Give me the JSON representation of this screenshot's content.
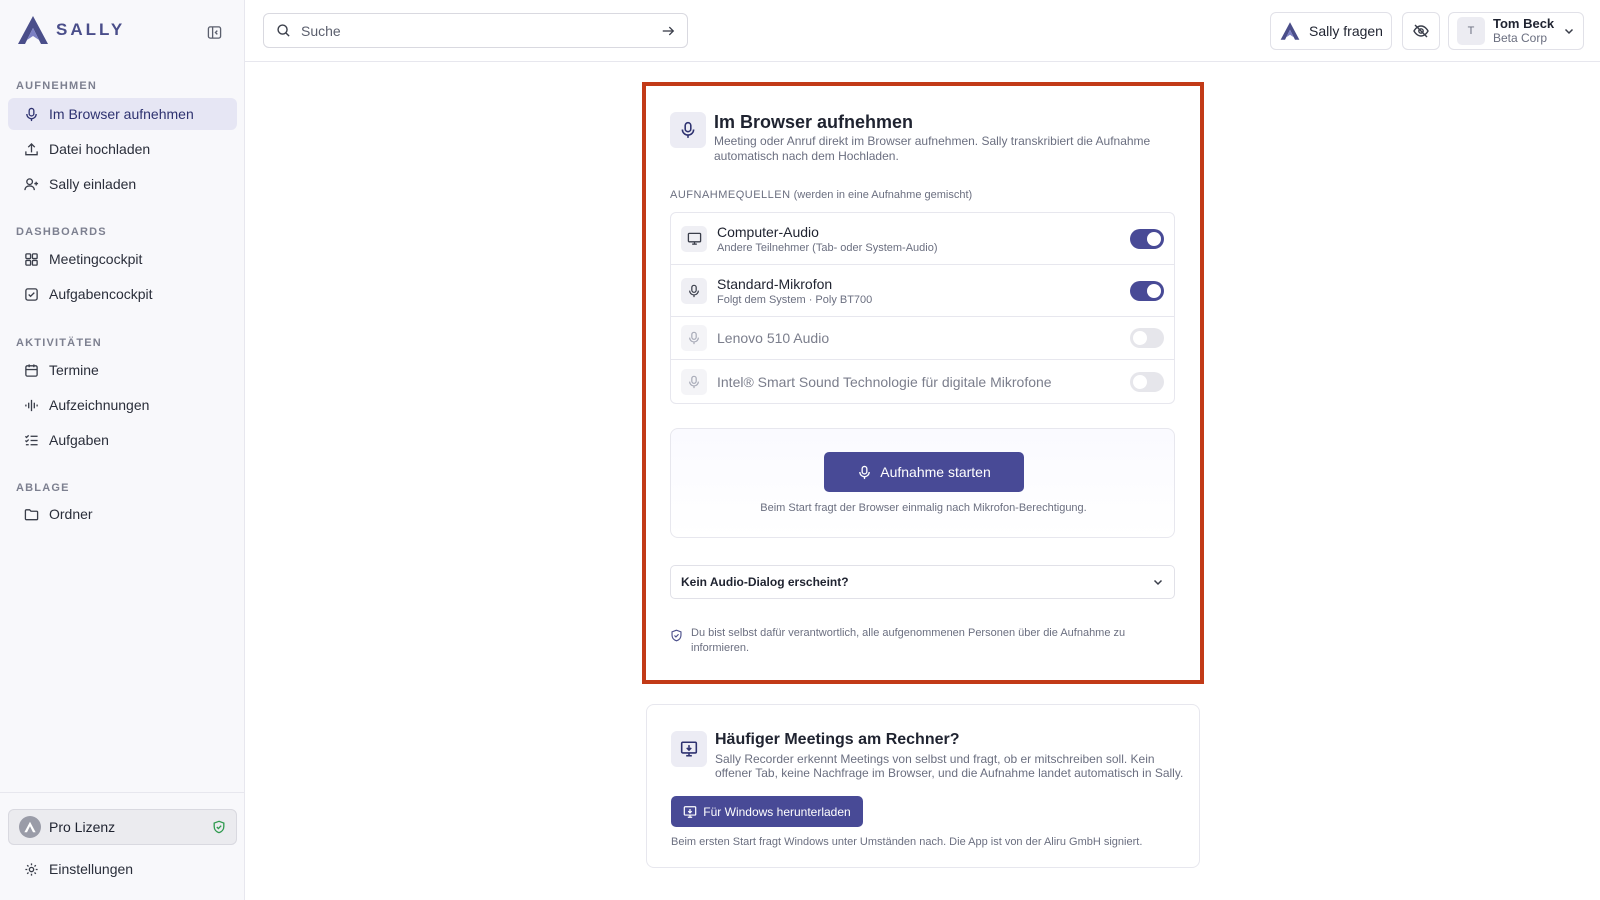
{
  "brand": {
    "name": "SALLY",
    "accent": "#484a96",
    "highlight": "#c23a17"
  },
  "sidebar": {
    "sections": {
      "record": "AUFNEHMEN",
      "dashboards": "DASHBOARDS",
      "activities": "AKTIVITÄTEN",
      "storage": "ABLAGE"
    },
    "items": [
      {
        "label": "Im Browser aufnehmen",
        "icon": "mic-icon"
      },
      {
        "label": "Datei hochladen",
        "icon": "upload-icon"
      },
      {
        "label": "Sally einladen",
        "icon": "user-plus-icon"
      },
      {
        "label": "Meetingcockpit",
        "icon": "grid-icon"
      },
      {
        "label": "Aufgabencockpit",
        "icon": "checkbox-icon"
      },
      {
        "label": "Termine",
        "icon": "calendar-icon"
      },
      {
        "label": "Aufzeichnungen",
        "icon": "waveform-icon"
      },
      {
        "label": "Aufgaben",
        "icon": "task-list-icon"
      },
      {
        "label": "Ordner",
        "icon": "folder-icon"
      }
    ],
    "license": "Pro Lizenz",
    "settings": "Einstellungen"
  },
  "topbar": {
    "search_placeholder": "Suche",
    "ask_label": "Sally fragen",
    "user": {
      "initial": "T",
      "name": "Tom Beck",
      "org": "Beta Corp"
    }
  },
  "record_card": {
    "title": "Im Browser aufnehmen",
    "description": "Meeting oder Anruf direkt im Browser aufnehmen. Sally transkribiert die Aufnahme automatisch nach dem Hochladen.",
    "sources_label": "AUFNAHMEQUELLEN",
    "sources_hint": "(werden in eine Aufnahme gemischt)",
    "sources": [
      {
        "name": "Computer-Audio",
        "sub": "Andere Teilnehmer (Tab- oder System-Audio)",
        "enabled": true
      },
      {
        "name": "Standard-Mikrofon",
        "sub": "Folgt dem System · Poly BT700",
        "enabled": true
      },
      {
        "name": "Lenovo 510 Audio",
        "sub": "",
        "enabled": false
      },
      {
        "name": "Intel® Smart Sound Technologie für digitale Mikrofone",
        "sub": "",
        "enabled": false
      }
    ],
    "start_button": "Aufnahme starten",
    "start_hint": "Beim Start fragt der Browser einmalig nach Mikrofon-Berechtigung.",
    "dialog_question": "Kein Audio-Dialog erscheint?",
    "responsibility_note": "Du bist selbst dafür verantwortlich, alle aufgenommenen Personen über die Aufnahme zu informieren."
  },
  "recorder_card": {
    "title": "Häufiger Meetings am Rechner?",
    "description": "Sally Recorder erkennt Meetings von selbst und fragt, ob er mitschreiben soll. Kein offener Tab, keine Nachfrage im Browser, und die Aufnahme landet automatisch in Sally.",
    "download_button": "Für Windows herunterladen",
    "footnote": "Beim ersten Start fragt Windows unter Umständen nach. Die App ist von der Aliru GmbH signiert."
  }
}
